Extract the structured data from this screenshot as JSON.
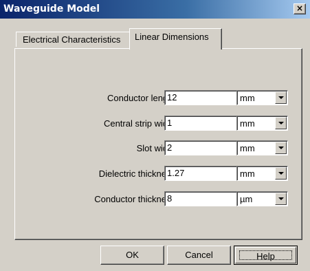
{
  "window": {
    "title": "Waveguide Model",
    "close_glyph": "×"
  },
  "tabs": [
    {
      "label": "Electrical Characteristics",
      "active": false
    },
    {
      "label": "Linear Dimensions",
      "active": true
    }
  ],
  "fields": [
    {
      "label": "Conductor length",
      "value": "12",
      "unit": "mm"
    },
    {
      "label": "Central strip width",
      "value": "1",
      "unit": "mm"
    },
    {
      "label": "Slot width",
      "value": "2",
      "unit": "mm"
    },
    {
      "label": "Dielectric thickness",
      "value": "1.27",
      "unit": "mm"
    },
    {
      "label": "Conductor thickness",
      "value": "8",
      "unit": "µm"
    }
  ],
  "buttons": {
    "ok": "OK",
    "cancel": "Cancel",
    "help": "Help"
  },
  "icons": {
    "close": "close-icon",
    "dropdown": "chevron-down-icon"
  },
  "colors": {
    "titlebar_start": "#0a246a",
    "titlebar_end": "#a6caf0",
    "face": "#d4d0c8"
  }
}
